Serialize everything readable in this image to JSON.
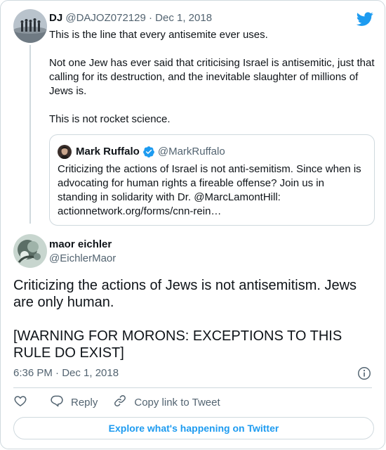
{
  "parent": {
    "name": "DJ",
    "handle": "@DAJOZ072129",
    "separator": "·",
    "date": "Dec 1, 2018",
    "paragraphs": [
      "This is the line that every antisemite ever uses.",
      "Not one Jew has ever said that criticising Israel is antisemitic, just that calling for its destruction, and the inevitable slaughter of millions of Jews is.",
      "This is not rocket science."
    ]
  },
  "quote": {
    "name": "Mark Ruffalo",
    "handle": "@MarkRuffalo",
    "text": "Criticizing the actions of Israel is not anti-semitism. Since when is advocating for human rights a fireable offense? Join us in standing in solidarity with Dr. @MarcLamontHill: actionnetwork.org/forms/cnn-rein…"
  },
  "tweet": {
    "name": "maor eichler",
    "handle": "@EichlerMaor",
    "paragraphs": [
      "Criticizing the actions of Jews is not antisemitism. Jews are only human.",
      "[WARNING FOR MORONS: EXCEPTIONS TO THIS RULE DO EXIST]"
    ],
    "timestamp": "6:36 PM · Dec 1, 2018"
  },
  "actions": {
    "reply": "Reply",
    "copy_link": "Copy link to Tweet"
  },
  "explore": "Explore what's happening on Twitter",
  "colors": {
    "twitter_blue": "#1d9bf0",
    "text_primary": "#0f1419",
    "text_secondary": "#536471",
    "border": "#cfd9de"
  },
  "icons": [
    "twitter-bird-icon",
    "verified-icon",
    "info-icon",
    "heart-icon",
    "reply-icon",
    "link-icon"
  ]
}
